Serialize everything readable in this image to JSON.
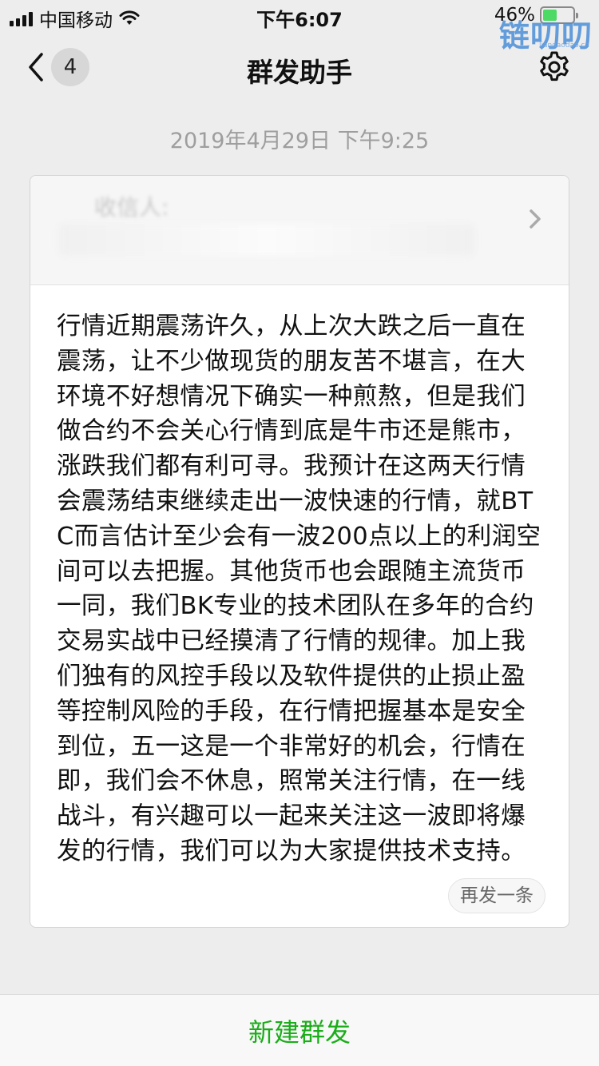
{
  "status_bar": {
    "carrier": "中国移动",
    "time": "下午6:07",
    "battery_percent": "46%",
    "battery_level": 0.46
  },
  "watermark": {
    "text": "链叨叨",
    "subtext": "liandaodao.cn"
  },
  "nav": {
    "back_count": "4",
    "title": "群发助手"
  },
  "timestamp": "2019年4月29日 下午9:25",
  "card": {
    "recipients_label": "收信人:",
    "message": "行情近期震荡许久，从上次大跌之后一直在震荡，让不少做现货的朋友苦不堪言，在大环境不好想情况下确实一种煎熬，但是我们做合约不会关心行情到底是牛市还是熊市，涨跌我们都有利可寻。我预计在这两天行情会震荡结束继续走出一波快速的行情，就BTC而言估计至少会有一波200点以上的利润空间可以去把握。其他货币也会跟随主流货币一同，我们BK专业的技术团队在多年的合约交易实战中已经摸清了行情的规律。加上我们独有的风控手段以及软件提供的止损止盈等控制风险的手段，在行情把握基本是安全到位，五一这是一个非常好的机会，行情在即，我们会不休息，照常关注行情，在一线战斗，有兴趣可以一起来关注这一波即将爆发的行情，我们可以为大家提供技术支持。",
    "resend_label": "再发一条"
  },
  "bottom": {
    "new_broadcast_label": "新建群发"
  },
  "colors": {
    "background": "#ededed",
    "accent_green": "#1aad19",
    "timestamp_gray": "#9e9e9e"
  },
  "icons": {
    "back": "chevron-left-icon",
    "settings": "gear-icon",
    "recipients_arrow": "chevron-right-icon",
    "signal": "signal-bars-icon",
    "wifi": "wifi-icon",
    "battery": "battery-icon"
  }
}
